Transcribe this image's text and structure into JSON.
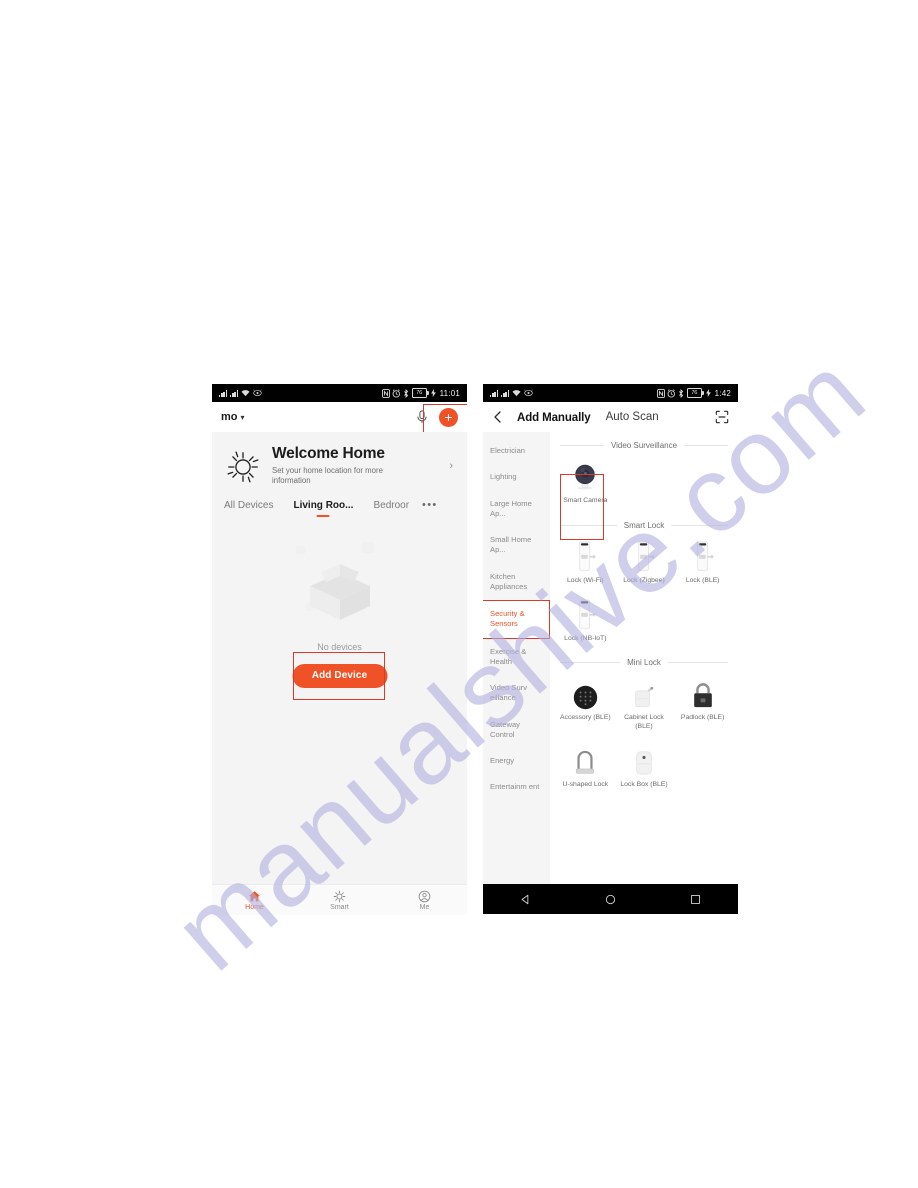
{
  "watermark": {
    "text": "manualshive.com",
    "color": "#b3b1e0"
  },
  "accent": {
    "orange": "#ef5226",
    "highlight_red": "#d93a2b"
  },
  "left_phone": {
    "status_bar": {
      "time": "11:01",
      "battery_level": "76",
      "icons": [
        "signal-bars-icon",
        "signal-bars-icon",
        "wifi-icon",
        "eye-comfort-icon",
        "nfc-icon",
        "alarm-icon",
        "bluetooth-icon",
        "battery-icon",
        "charging-bolt-icon"
      ]
    },
    "app_bar": {
      "home_name": "mo",
      "chevron": "⌄",
      "mic_icon": "microphone-icon",
      "add_icon": "plus-icon"
    },
    "welcome_card": {
      "icon": "sun-icon",
      "title": "Welcome Home",
      "subtitle": "Set your home location for more information",
      "chevron": "›"
    },
    "room_tabs": [
      {
        "label": "All Devices",
        "active": false
      },
      {
        "label": "Living Roo...",
        "active": true
      },
      {
        "label": "Bedroor",
        "active": false
      }
    ],
    "room_tabs_more": "•••",
    "empty_state": {
      "illustration": "empty-box-icon",
      "text": "No devices",
      "button_label": "Add Device"
    },
    "tab_bar": [
      {
        "label": "Home",
        "icon": "home-icon",
        "active": true
      },
      {
        "label": "Smart",
        "icon": "sun-icon",
        "active": false
      },
      {
        "label": "Me",
        "icon": "person-circle-icon",
        "active": false
      }
    ],
    "nav_bar": [
      {
        "icon": "back-triangle-icon"
      },
      {
        "icon": "home-circle-icon"
      },
      {
        "icon": "recents-square-icon"
      }
    ]
  },
  "right_phone": {
    "status_bar": {
      "time": "1:42",
      "battery_level": "76",
      "icons": [
        "signal-bars-icon",
        "signal-bars-icon",
        "wifi-icon",
        "eye-comfort-icon",
        "nfc-icon",
        "alarm-icon",
        "bluetooth-icon",
        "battery-icon",
        "charging-bolt-icon"
      ]
    },
    "app_bar": {
      "back_icon": "back-chevron-icon",
      "title": "Add Manually",
      "auto_scan": "Auto Scan",
      "scan_icon": "qr-scan-icon"
    },
    "categories": [
      {
        "label": "Electrician",
        "active": false
      },
      {
        "label": "Lighting",
        "active": false
      },
      {
        "label": "Large Home Ap...",
        "active": false
      },
      {
        "label": "Small Home Ap...",
        "active": false
      },
      {
        "label": "Kitchen Appliances",
        "active": false
      },
      {
        "label": "Security & Sensors",
        "active": true
      },
      {
        "label": "Exercise & Health",
        "active": false
      },
      {
        "label": "Video Surv eillance",
        "active": false
      },
      {
        "label": "Gateway Control",
        "active": false
      },
      {
        "label": "Energy",
        "active": false
      },
      {
        "label": "Entertainm ent",
        "active": false
      }
    ],
    "sections": [
      {
        "title": "Video Surveillance",
        "devices": [
          {
            "label": "Smart Camera",
            "icon": "camera-dome-icon",
            "highlighted": true
          }
        ]
      },
      {
        "title": "Smart Lock",
        "devices": [
          {
            "label": "Lock (Wi-Fi)",
            "icon": "door-lock-icon",
            "highlighted": false
          },
          {
            "label": "Lock (Zigbee)",
            "icon": "door-lock-icon",
            "highlighted": false
          },
          {
            "label": "Lock (BLE)",
            "icon": "door-lock-icon",
            "highlighted": false
          },
          {
            "label": "Lock (NB-IoT)",
            "icon": "door-lock-icon",
            "highlighted": false
          }
        ]
      },
      {
        "title": "Mini Lock",
        "devices": [
          {
            "label": "Accessory (BLE)",
            "icon": "keypad-disc-icon",
            "highlighted": false
          },
          {
            "label": "Cabinet Lock (BLE)",
            "icon": "cabinet-lock-icon",
            "highlighted": false
          },
          {
            "label": "Padlock (BLE)",
            "icon": "padlock-icon",
            "highlighted": false
          },
          {
            "label": "U-shaped Lock",
            "icon": "u-lock-icon",
            "highlighted": false
          },
          {
            "label": "Lock Box (BLE)",
            "icon": "lock-box-icon",
            "highlighted": false
          }
        ]
      }
    ],
    "nav_bar": [
      {
        "icon": "back-triangle-icon"
      },
      {
        "icon": "home-circle-icon"
      },
      {
        "icon": "recents-square-icon"
      }
    ]
  }
}
